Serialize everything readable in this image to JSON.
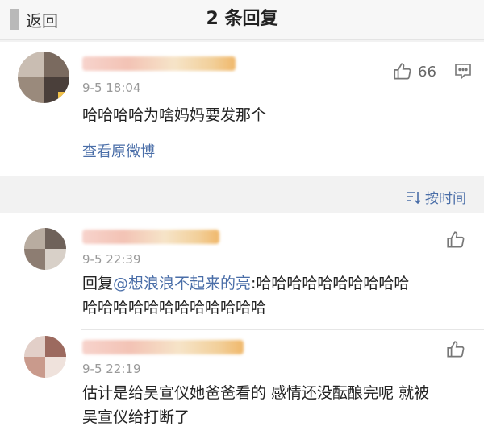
{
  "nav": {
    "back_label": "返回",
    "title": "2 条回复"
  },
  "main_comment": {
    "time": "9-5 18:04",
    "text": "哈哈哈哈为啥妈妈要发那个",
    "like_count": "66",
    "view_original": "查看原微博"
  },
  "sort": {
    "label": "按时间"
  },
  "replies": [
    {
      "time": "9-5 22:39",
      "prefix": "回复",
      "mention": "@想浪浪不起来的亮",
      "text_line1": ":哈哈哈哈哈哈哈哈哈哈",
      "text_line2": "哈哈哈哈哈哈哈哈哈哈哈哈"
    },
    {
      "time": "9-5 22:19",
      "text_line1": "估计是给吴宣仪她爸爸看的 感情还没酝酿完呢 就被",
      "text_line2": "吴宣仪给打断了"
    }
  ],
  "colors": {
    "link": "#4a6ea8",
    "background": "#f2f2f2",
    "time": "#999999"
  }
}
